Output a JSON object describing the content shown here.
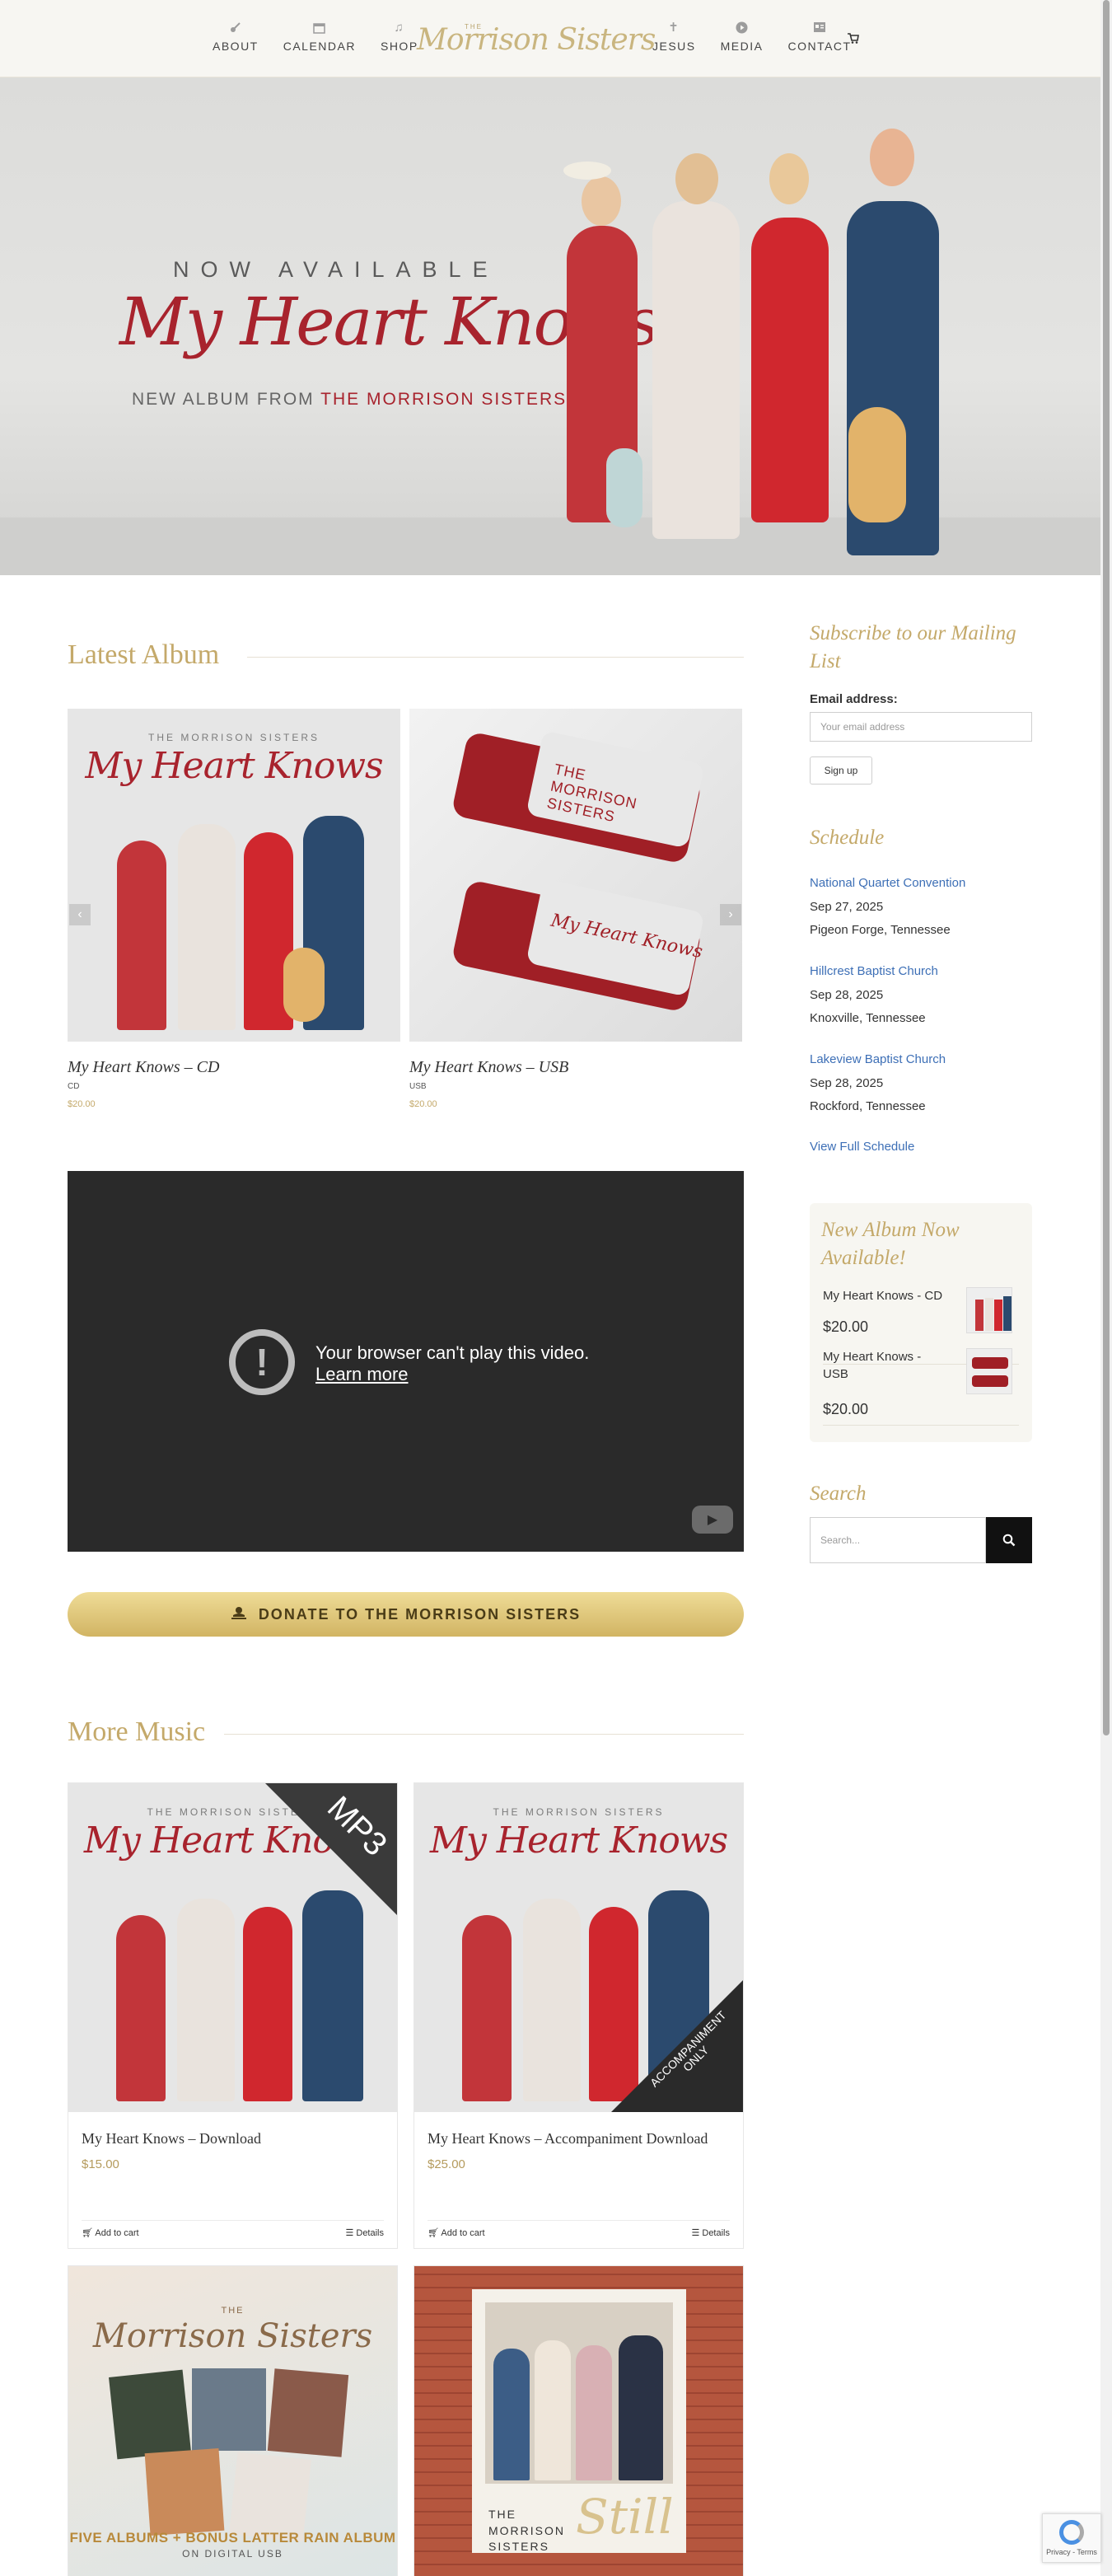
{
  "colors": {
    "gold": "#c4a96a",
    "crimson": "#a8232d",
    "link_blue": "#3d6fb6",
    "header_bg": "#f7f6f2"
  },
  "header": {
    "logo_small": "THE",
    "logo_script": "Morrison Sisters",
    "nav_left": [
      {
        "label": "ABOUT",
        "icon": "guitar-icon"
      },
      {
        "label": "CALENDAR",
        "icon": "calendar-icon"
      },
      {
        "label": "SHOP",
        "icon": "music-note-icon"
      }
    ],
    "nav_right": [
      {
        "label": "JESUS",
        "icon": "cross-icon"
      },
      {
        "label": "MEDIA",
        "icon": "play-circle-icon"
      },
      {
        "label": "CONTACT",
        "icon": "contact-card-icon"
      }
    ],
    "cart_icon": "cart-icon"
  },
  "hero": {
    "kicker": "NOW AVAILABLE",
    "title": "My Heart Knows",
    "subtitle_prefix": "NEW ALBUM FROM",
    "subtitle_accent": "THE MORRISON SISTERS"
  },
  "latest_album": {
    "title": "Latest Album",
    "items": [
      {
        "name": "My Heart Knows – CD",
        "format": "CD",
        "price": "$20.00",
        "cover_top": "THE MORRISON SISTERS",
        "cover_script": "My Heart Knows"
      },
      {
        "name": "My Heart Knows – USB",
        "format": "USB",
        "price": "$20.00",
        "usb_brand": "THE MORRISON SISTERS",
        "usb_script": "My Heart Knows"
      }
    ],
    "prev_icon": "chevron-left-icon",
    "next_icon": "chevron-right-icon"
  },
  "video": {
    "error_text": "Your browser can't play this video.",
    "link_text": "Learn more"
  },
  "donate": {
    "label": "DONATE TO THE MORRISON SISTERS",
    "icon": "donate-hand-icon"
  },
  "more_music": {
    "title": "More Music",
    "items": [
      {
        "name": "My Heart Knows – Download",
        "price": "$15.00",
        "ribbon": "MP3",
        "add_to_cart": "Add to cart",
        "details": "Details"
      },
      {
        "name": "My Heart Knows – Accompaniment Download",
        "price": "$25.00",
        "ribbon": "ACCOMPANIMENT ONLY",
        "add_to_cart": "Add to cart",
        "details": "Details"
      }
    ],
    "bottom_covers": [
      {
        "top": "THE",
        "script": "Morrison Sisters",
        "caption": "FIVE ALBUMS + BONUS LATTER RAIN ALBUM",
        "caption2": "ON DIGITAL USB"
      },
      {
        "brand": "THE MORRISON SISTERS",
        "script": "Still"
      }
    ]
  },
  "sidebar": {
    "mailing_title": "Subscribe to our Mailing List",
    "email_label": "Email address:",
    "email_placeholder": "Your email address",
    "signup": "Sign up",
    "schedule_title": "Schedule",
    "events": [
      {
        "name": "National Quartet Convention",
        "date": "Sep 27, 2025",
        "location": "Pigeon Forge, Tennessee"
      },
      {
        "name": "Hillcrest Baptist Church",
        "date": "Sep 28, 2025",
        "location": "Knoxville, Tennessee"
      },
      {
        "name": "Lakeview Baptist Church",
        "date": "Sep 28, 2025",
        "location": "Rockford, Tennessee"
      }
    ],
    "view_schedule": "View Full Schedule",
    "promo_title": "New Album Now Available!",
    "promo_items": [
      {
        "name": "My Heart Knows - CD",
        "price": "$20.00"
      },
      {
        "name": "My Heart Knows - USB",
        "price": "$20.00"
      }
    ],
    "search_title": "Search",
    "search_placeholder": "Search...",
    "search_icon": "search-icon"
  },
  "recaptcha": {
    "text": "Privacy - Terms"
  }
}
